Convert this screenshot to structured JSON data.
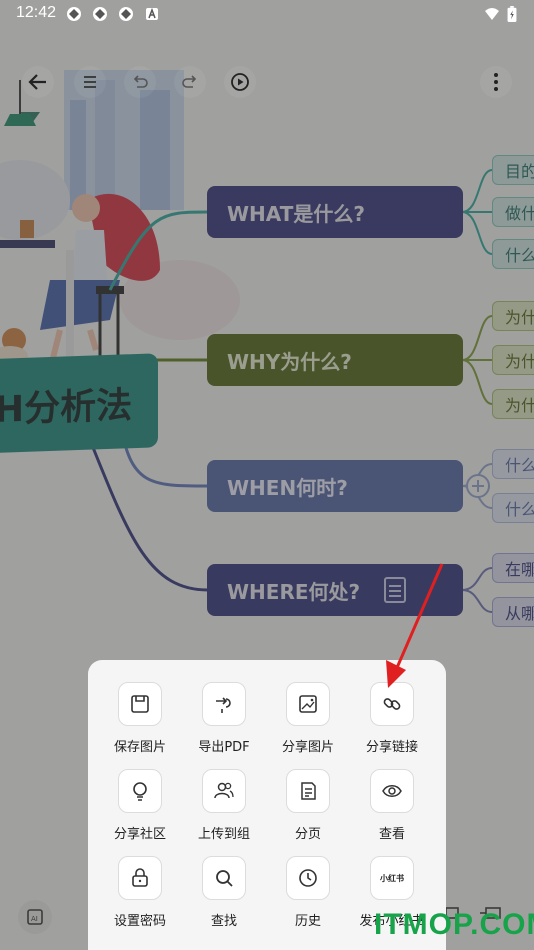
{
  "status_bar": {
    "time": "12:42",
    "notification_icons": [
      "app-icon",
      "app-icon",
      "app-icon",
      "a-badge-icon"
    ],
    "right_icons": [
      "wifi-icon",
      "battery-charging-icon"
    ]
  },
  "toolbar": {
    "left_icons": [
      "back-arrow-icon",
      "outline-list-icon",
      "undo-icon",
      "redo-icon",
      "play-icon"
    ],
    "right_icon": "more-vertical-icon"
  },
  "mindmap": {
    "central": "H分析法",
    "branches": [
      {
        "label": "WHAT是什么?",
        "color": "#30317a",
        "children": [
          "目的",
          "做什",
          "什么"
        ]
      },
      {
        "label": "WHY为什么?",
        "color": "#4d6212",
        "children": [
          "为什",
          "为什",
          "为什"
        ]
      },
      {
        "label": "WHEN何时?",
        "color": "#5063a0",
        "children": [
          "什么",
          "什么"
        ]
      },
      {
        "label": "WHERE何处?",
        "color": "#2f3177",
        "children": [
          "在哪",
          "从哪"
        ]
      }
    ]
  },
  "share_sheet": {
    "items": [
      {
        "label": "保存图片",
        "icon": "save-image-icon"
      },
      {
        "label": "导出PDF",
        "icon": "export-pdf-icon"
      },
      {
        "label": "分享图片",
        "icon": "share-image-icon"
      },
      {
        "label": "分享链接",
        "icon": "link-icon"
      },
      {
        "label": "分享社区",
        "icon": "lightbulb-icon"
      },
      {
        "label": "上传到组",
        "icon": "group-upload-icon"
      },
      {
        "label": "分页",
        "icon": "pagination-icon"
      },
      {
        "label": "查看",
        "icon": "eye-icon"
      },
      {
        "label": "设置密码",
        "icon": "lock-icon"
      },
      {
        "label": "查找",
        "icon": "search-icon"
      },
      {
        "label": "历史",
        "icon": "history-clock-icon"
      },
      {
        "label": "发布小红书",
        "icon": "xiaohongshu-icon",
        "icon_text": "小红书"
      }
    ]
  },
  "watermark": "ITMOP.COM",
  "colors": {
    "arrow": "#e02020",
    "watermark": "#17a34a"
  }
}
